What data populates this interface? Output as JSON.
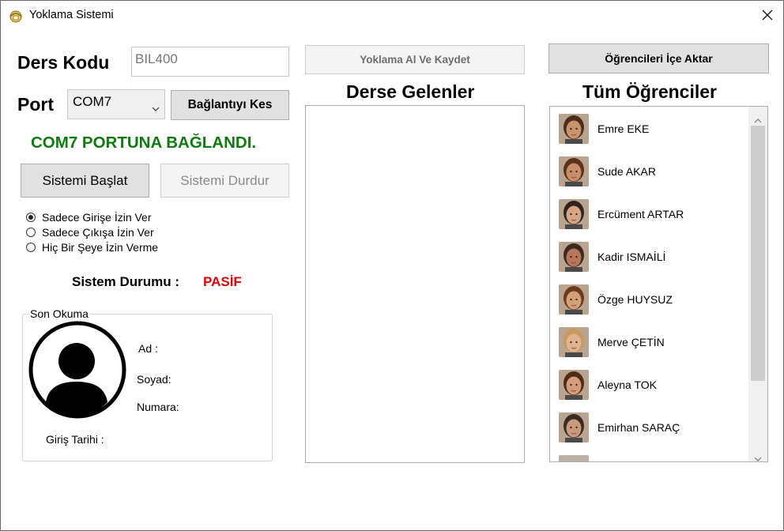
{
  "window": {
    "title": "Yoklama Sistemi"
  },
  "course": {
    "label": "Ders Kodu",
    "value": "BIL400"
  },
  "port": {
    "label": "Port",
    "selected": "COM7",
    "disconnect_label": "Bağlantıyı Kes",
    "connected_message": "COM7 PORTUNA BAĞLANDI."
  },
  "system": {
    "start_label": "Sistemi Başlat",
    "stop_label": "Sistemi Durdur",
    "status_label": "Sistem Durumu :",
    "status_value": "PASİF"
  },
  "mode_options": [
    {
      "label": "Sadece Girişe İzin Ver",
      "selected": true
    },
    {
      "label": "Sadece Çıkışa İzin Ver",
      "selected": false
    },
    {
      "label": "Hiç Bir Şeye İzin Verme",
      "selected": false
    }
  ],
  "last_read": {
    "title": "Son Okuma",
    "name_label": "Ad :",
    "surname_label": "Soyad:",
    "number_label": "Numara:",
    "entry_date_label": "Giriş Tarihi :"
  },
  "attendance": {
    "save_button": "Yoklama Al Ve Kaydet",
    "title": "Derse Gelenler"
  },
  "students": {
    "import_button": "Öğrencileri İçe Aktar",
    "title": "Tüm Öğrenciler",
    "items": [
      {
        "name": "Emre EKE",
        "skin": "#c9946d",
        "hair": "#4a2e1a"
      },
      {
        "name": "Sude AKAR",
        "skin": "#c98d6a",
        "hair": "#5a3218"
      },
      {
        "name": "Ercüment ARTAR",
        "skin": "#d7a486",
        "hair": "#2f2520"
      },
      {
        "name": "Kadir ISMAİLİ",
        "skin": "#b8775a",
        "hair": "#3b2a22"
      },
      {
        "name": "Özge HUYSUZ",
        "skin": "#d4a078",
        "hair": "#6b3b1c"
      },
      {
        "name": "Merve ÇETİN",
        "skin": "#e0b391",
        "hair": "#c79a5d"
      },
      {
        "name": "Aleyna TOK",
        "skin": "#d59c7b",
        "hair": "#4e2c16"
      },
      {
        "name": "Emirhan SARAÇ",
        "skin": "#c99a7c",
        "hair": "#3a2b22"
      }
    ]
  }
}
